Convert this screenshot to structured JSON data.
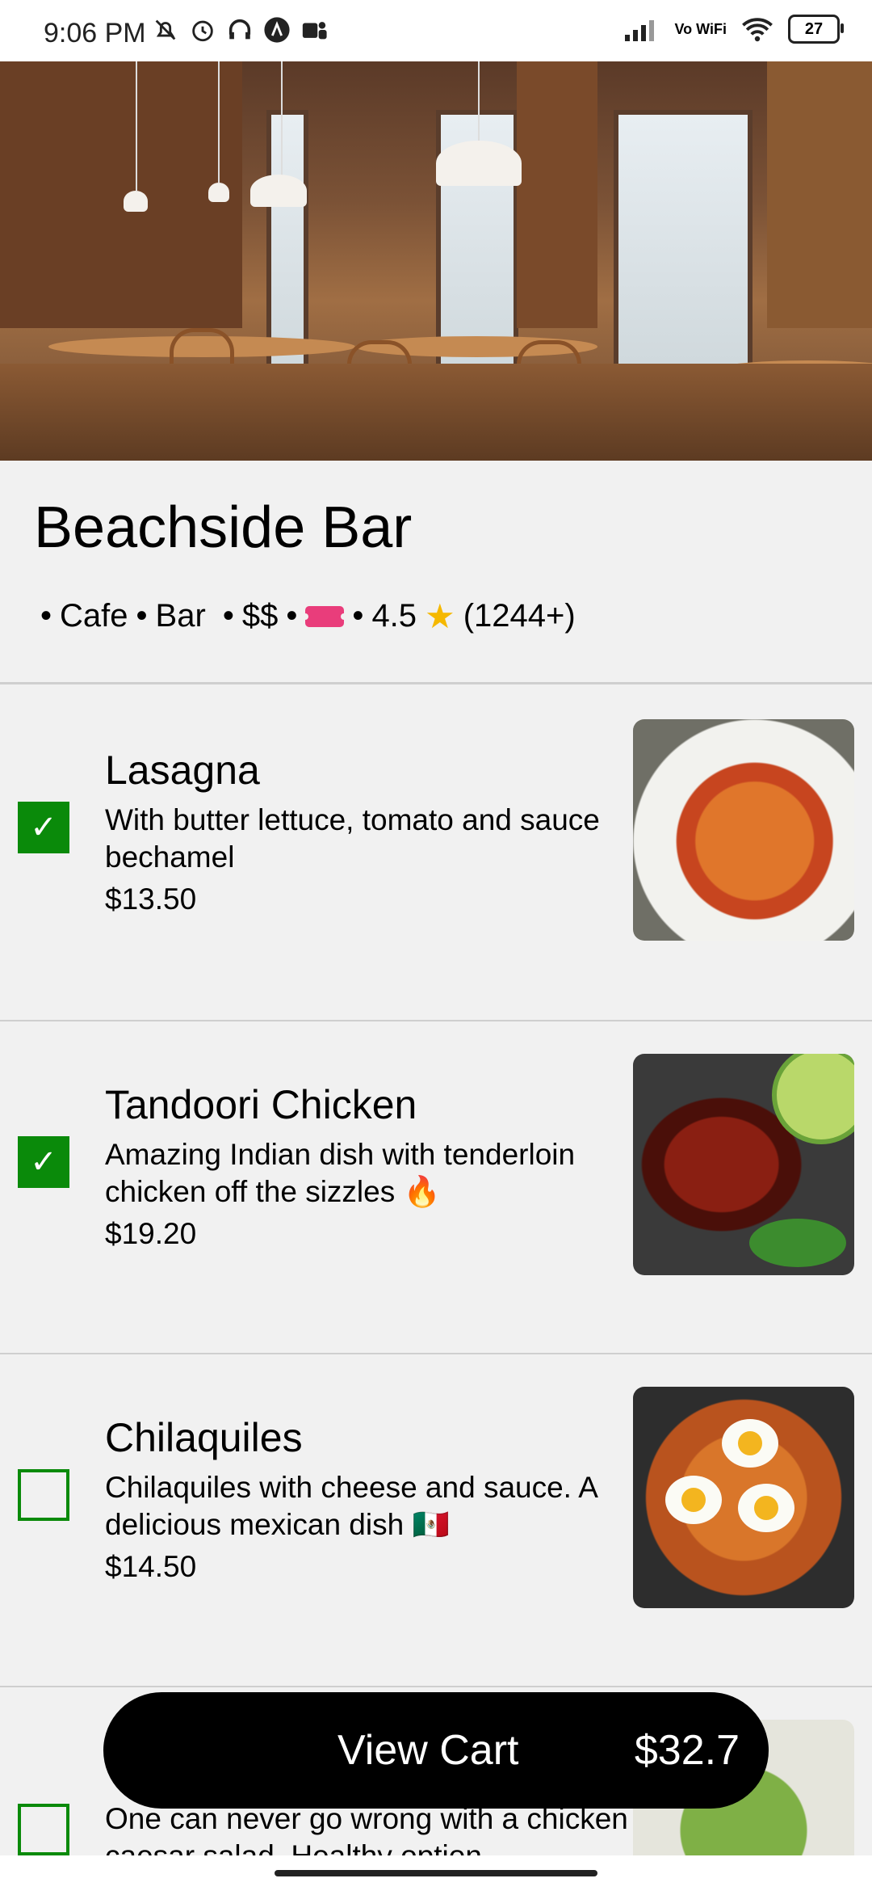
{
  "status_bar": {
    "time": "9:06 PM",
    "left_icons": [
      "bell-off-icon",
      "alarm-icon",
      "headset-icon",
      "a-circle-icon",
      "teams-icon"
    ],
    "vowifi": "Vo WiFi",
    "battery": "27"
  },
  "restaurant": {
    "name": "Beachside Bar",
    "tags": [
      "Cafe",
      "Bar"
    ],
    "price_level": "$$",
    "rating": "4.5",
    "reviews": "(1244+)",
    "hero_image": "restaurant-interior"
  },
  "menu_items": [
    {
      "name": "Lasagna",
      "description": "With butter lettuce, tomato and sauce bechamel",
      "price": "$13.50",
      "checked": true
    },
    {
      "name": "Tandoori Chicken",
      "description": "Amazing Indian dish with tenderloin chicken off the sizzles 🔥",
      "price": "$19.20",
      "checked": true
    },
    {
      "name": "Chilaquiles",
      "description": "Chilaquiles with cheese and sauce. A delicious mexican dish 🇲🇽",
      "price": "$14.50",
      "checked": false
    },
    {
      "description": "One can never go wrong with a chicken caesar salad. Healthy option",
      "checked": false
    }
  ],
  "cart": {
    "label": "View Cart",
    "total": "$32.7"
  },
  "colors": {
    "accent_green": "#0a8a0a",
    "cart_background": "#000000",
    "page_background": "#f1f1f1"
  }
}
